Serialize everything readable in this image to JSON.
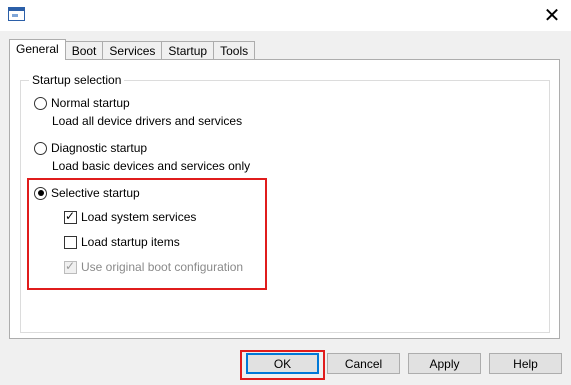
{
  "window": {
    "title_icon": "msconfig-icon",
    "close_label": "✕"
  },
  "tabs": [
    {
      "label": "General",
      "active": true
    },
    {
      "label": "Boot"
    },
    {
      "label": "Services"
    },
    {
      "label": "Startup"
    },
    {
      "label": "Tools"
    }
  ],
  "general": {
    "group_label": "Startup selection",
    "normal": {
      "label": "Normal startup",
      "desc": "Load all device drivers and services",
      "checked": false
    },
    "diagnostic": {
      "label": "Diagnostic startup",
      "desc": "Load basic devices and services only",
      "checked": false
    },
    "selective": {
      "label": "Selective startup",
      "checked": true,
      "options": [
        {
          "label": "Load system services",
          "checked": true,
          "enabled": true
        },
        {
          "label": "Load startup items",
          "checked": false,
          "enabled": true
        },
        {
          "label": "Use original boot configuration",
          "checked": true,
          "enabled": false
        }
      ]
    }
  },
  "buttons": {
    "ok": "OK",
    "cancel": "Cancel",
    "apply": "Apply",
    "help": "Help"
  },
  "colors": {
    "highlight": "#e01c1c",
    "default_button_border": "#0078d7"
  }
}
